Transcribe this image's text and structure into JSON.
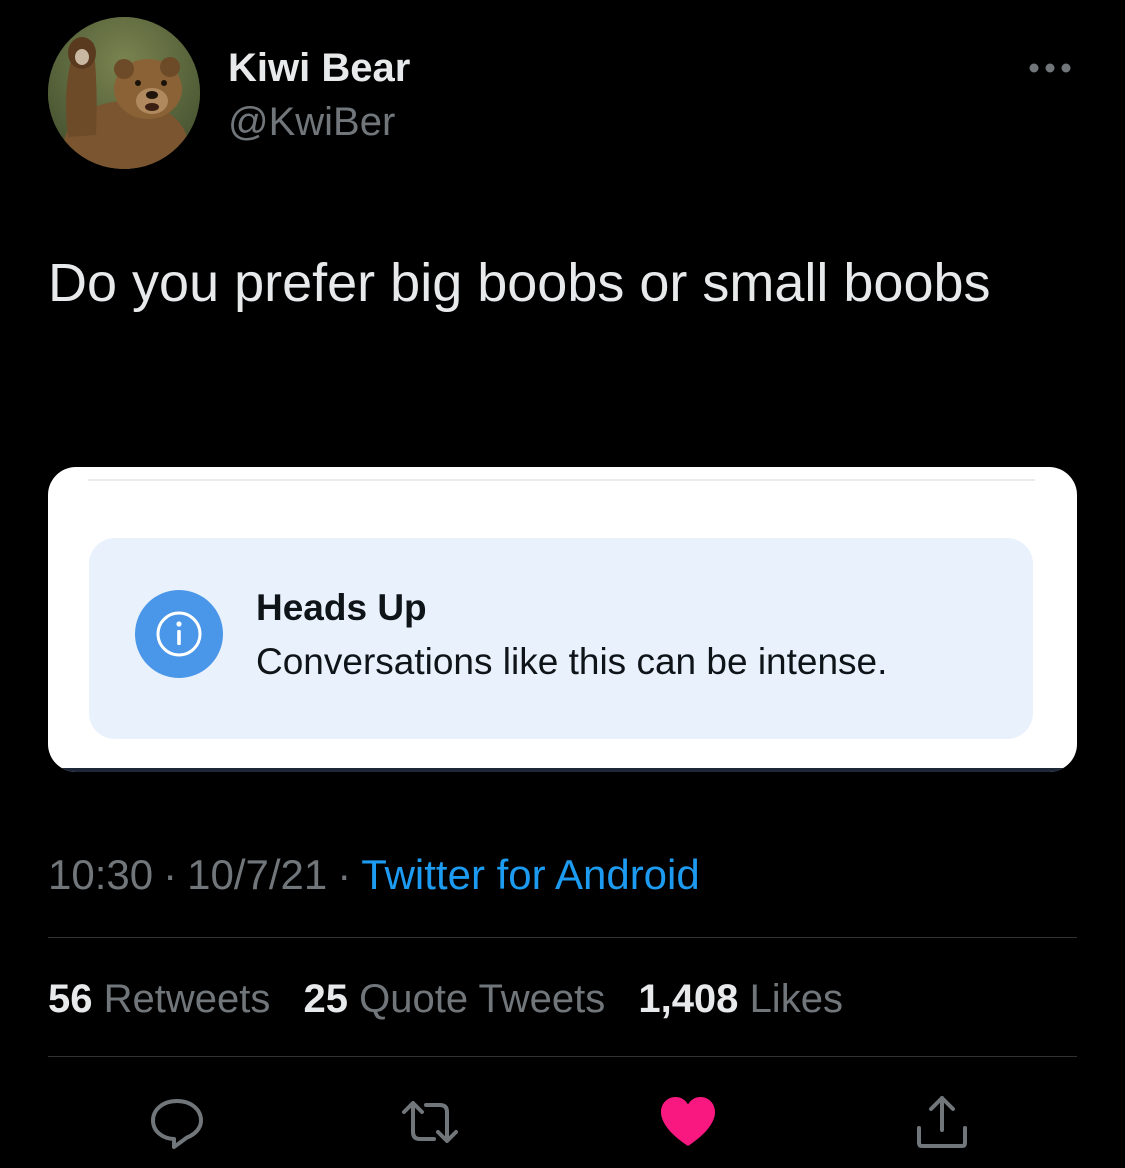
{
  "user": {
    "display_name": "Kiwi Bear",
    "handle": "@KwiBer",
    "avatar_icon": "bear-avatar"
  },
  "tweet": {
    "text": "Do you prefer big boobs or small boobs"
  },
  "notice": {
    "title": "Heads Up",
    "body": "Conversations like this can be intense.",
    "icon": "info-icon",
    "accent": "#4a96e8"
  },
  "meta": {
    "time": "10:30",
    "date": "10/7/21",
    "separator": "·",
    "source": "Twitter for Android"
  },
  "stats": {
    "retweets_count": "56",
    "retweets_label": "Retweets",
    "quotes_count": "25",
    "quotes_label": "Quote Tweets",
    "likes_count": "1,408",
    "likes_label": "Likes"
  },
  "actions": {
    "reply_icon": "reply-icon",
    "retweet_icon": "retweet-icon",
    "like_icon": "heart-icon",
    "like_color": "#f91880",
    "share_icon": "share-icon"
  },
  "colors": {
    "background": "#000000",
    "primary_text": "#e7e9ea",
    "secondary_text": "#71767b",
    "link": "#1d9bf0"
  }
}
